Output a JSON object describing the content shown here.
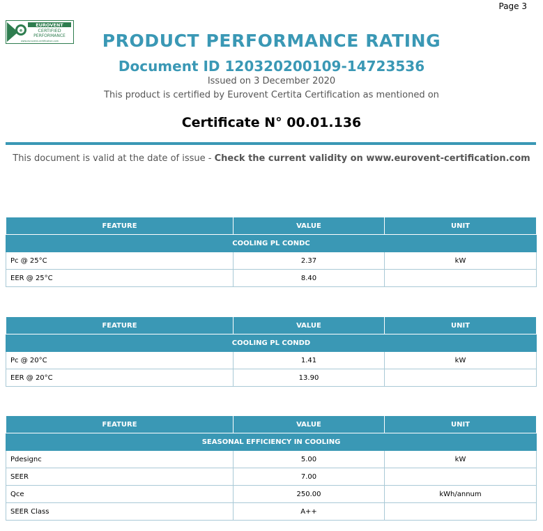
{
  "page_number": "Page 3",
  "logo": {
    "line1": "EUROVENT",
    "line2": "CERTIFIED",
    "line3": "PERFORMANCE",
    "url": "www.eurovent-certification.com"
  },
  "header": {
    "title": "PRODUCT PERFORMANCE RATING",
    "document_id": "Document ID 120320200109-14723536",
    "issued": "Issued on  3 December 2020",
    "certified_text": "This product is certified by Eurovent Certita Certification as mentioned on",
    "certificate": "Certificate N° 00.01.136"
  },
  "validity": {
    "text": "This document is valid at the date of issue - ",
    "bold": "Check the current validity on www.eurovent-certification.com"
  },
  "tables": [
    {
      "headers": [
        "FEATURE",
        "VALUE",
        "UNIT"
      ],
      "section": "COOLING PL CONDC",
      "rows": [
        {
          "feature": "Pc @ 25°C",
          "value": "2.37",
          "unit": "kW"
        },
        {
          "feature": "EER @ 25°C",
          "value": "8.40",
          "unit": ""
        }
      ]
    },
    {
      "headers": [
        "FEATURE",
        "VALUE",
        "UNIT"
      ],
      "section": "COOLING PL CONDD",
      "rows": [
        {
          "feature": "Pc @ 20°C",
          "value": "1.41",
          "unit": "kW"
        },
        {
          "feature": "EER @ 20°C",
          "value": "13.90",
          "unit": ""
        }
      ]
    },
    {
      "headers": [
        "FEATURE",
        "VALUE",
        "UNIT"
      ],
      "section": "SEASONAL EFFICIENCY IN COOLING",
      "rows": [
        {
          "feature": "Pdesignc",
          "value": "5.00",
          "unit": "kW"
        },
        {
          "feature": "SEER",
          "value": "7.00",
          "unit": ""
        },
        {
          "feature": "Qce",
          "value": "250.00",
          "unit": "kWh/annum"
        },
        {
          "feature": "SEER Class",
          "value": "A++",
          "unit": ""
        }
      ]
    }
  ],
  "colors": {
    "accent": "#3a98b5",
    "logo_green": "#2e7d4f"
  }
}
